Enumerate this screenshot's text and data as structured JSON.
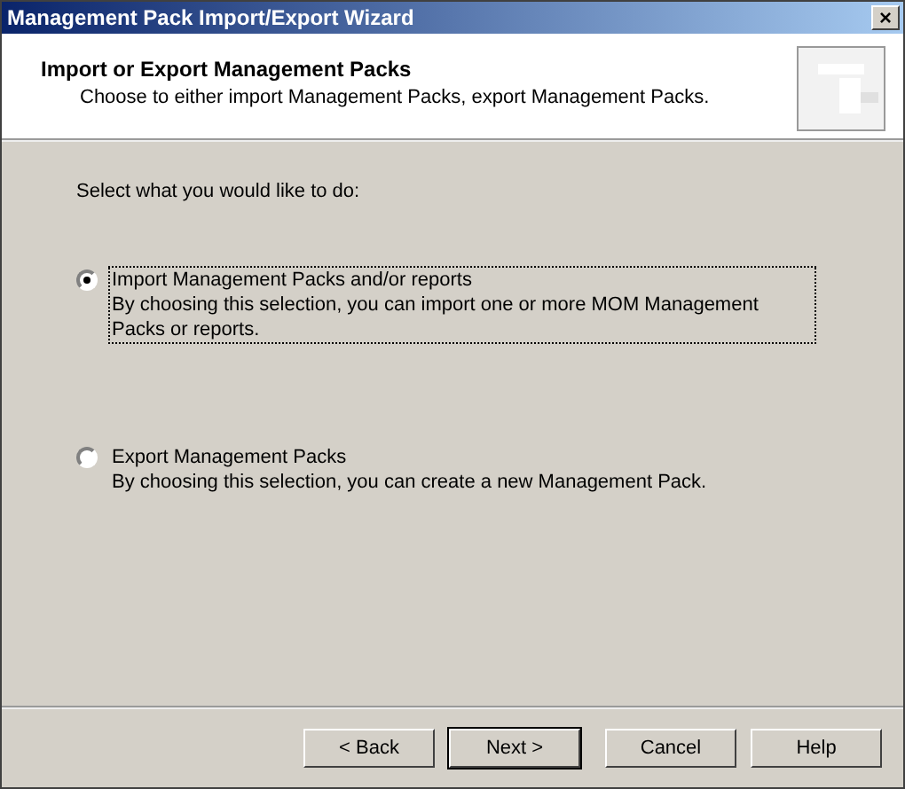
{
  "window": {
    "title": "Management Pack Import/Export Wizard",
    "close": "×"
  },
  "header": {
    "title": "Import or Export Management Packs",
    "subtitle": "Choose to either import Management Packs, export Management Packs."
  },
  "prompt": "Select what you would like to do:",
  "options": [
    {
      "label": "Import Management Packs and/or reports",
      "description": "By choosing this selection, you can import one or more MOM Management Packs or reports.",
      "selected": true,
      "focused": true
    },
    {
      "label": "Export Management Packs",
      "description": "By choosing this selection, you can create a new Management Pack.",
      "selected": false,
      "focused": false
    }
  ],
  "buttons": [
    {
      "label": "< Back",
      "default": false
    },
    {
      "label": "Next >",
      "default": true
    },
    {
      "label": "Cancel",
      "default": false
    },
    {
      "label": "Help",
      "default": false
    }
  ]
}
